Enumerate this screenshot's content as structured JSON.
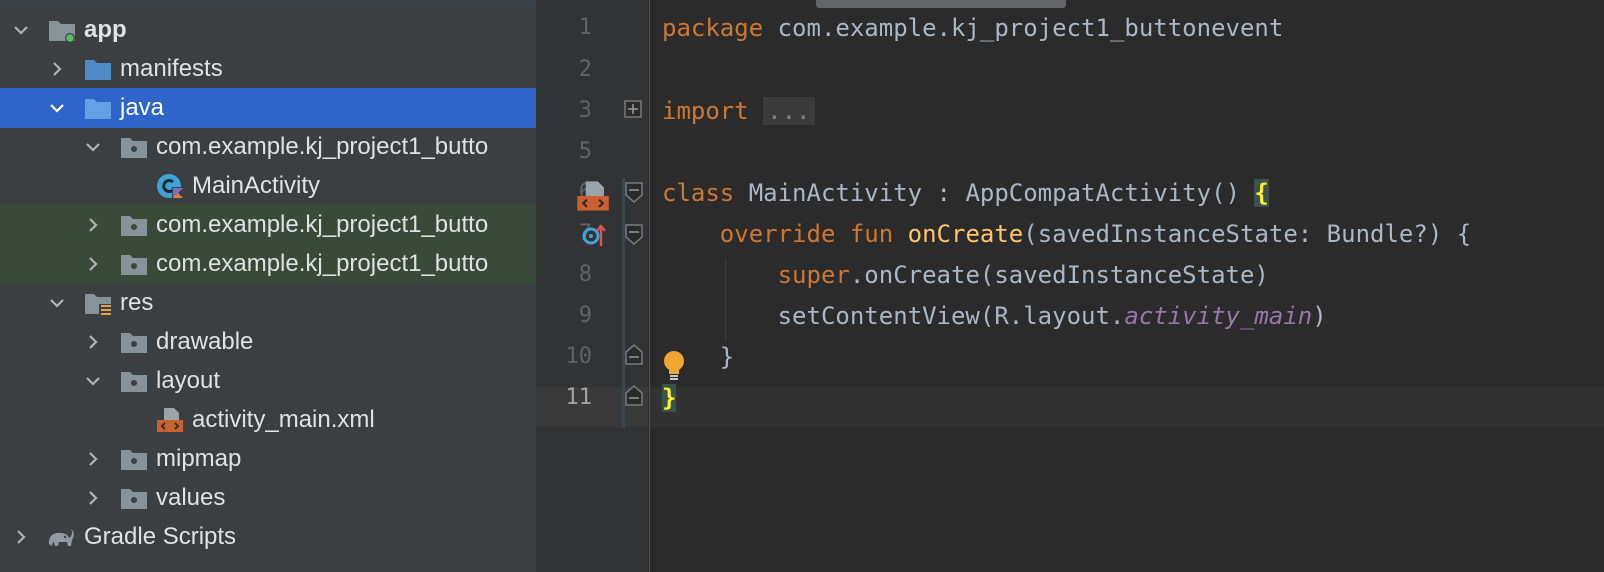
{
  "project_tree": {
    "items": [
      {
        "label": "app",
        "icon": "module-folder-icon"
      },
      {
        "label": "manifests",
        "icon": "folder-icon"
      },
      {
        "label": "java",
        "icon": "folder-icon"
      },
      {
        "label": "com.example.kj_project1_butto",
        "icon": "package-icon"
      },
      {
        "label": "MainActivity",
        "icon": "kotlin-class-icon"
      },
      {
        "label": "com.example.kj_project1_butto",
        "icon": "package-icon"
      },
      {
        "label": "com.example.kj_project1_butto",
        "icon": "package-icon"
      },
      {
        "label": "res",
        "icon": "resources-folder-icon"
      },
      {
        "label": "drawable",
        "icon": "package-icon"
      },
      {
        "label": "layout",
        "icon": "package-icon"
      },
      {
        "label": "activity_main.xml",
        "icon": "layout-xml-icon"
      },
      {
        "label": "mipmap",
        "icon": "package-icon"
      },
      {
        "label": "values",
        "icon": "package-icon"
      },
      {
        "label": "Gradle Scripts",
        "icon": "gradle-elephant-icon"
      }
    ],
    "selected_item": "java"
  },
  "editor": {
    "line_numbers": [
      "1",
      "2",
      "3",
      "5",
      "6",
      "7",
      "8",
      "9",
      "10",
      "11"
    ],
    "current_line": "11",
    "tokens": {
      "l1_kw": "package",
      "l1_rest": " com.example.kj_project1_buttonevent",
      "l3_kw": "import",
      "l3_folded": "...",
      "l6_kw": "class",
      "l6_rest": " MainActivity : AppCompatActivity() ",
      "l6_brace": "{",
      "l7_indent": "    ",
      "l7_kw1": "override",
      "l7_sp1": " ",
      "l7_kw2": "fun",
      "l7_sp2": " ",
      "l7_fn": "onCreate",
      "l7_rest": "(savedInstanceState: Bundle?) {",
      "l8_indent": "        ",
      "l8_kw": "super",
      "l8_rest": ".onCreate(savedInstanceState)",
      "l9_indent": "        ",
      "l9_pre": "setContentView(R.layout.",
      "l9_it": "activity_main",
      "l9_post": ")",
      "l10_text": "    }",
      "l11_brace": "}"
    }
  },
  "colors": {
    "tree_bg": "#3c3f41",
    "selection": "#2f65ca",
    "editor_bg": "#2b2b2b",
    "keyword": "#cc7832",
    "function": "#ffc66d",
    "identifier": "#a9b7c6",
    "field_italic": "#9876aa"
  }
}
